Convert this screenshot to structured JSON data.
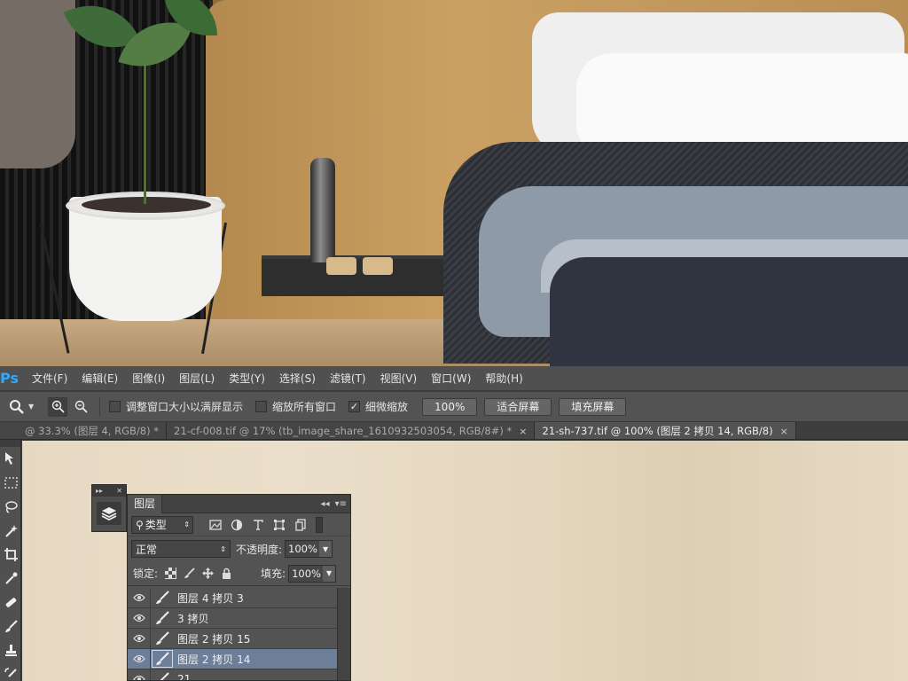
{
  "menu": {
    "logo": "Ps",
    "items": [
      "文件(F)",
      "编辑(E)",
      "图像(I)",
      "图层(L)",
      "类型(Y)",
      "选择(S)",
      "滤镜(T)",
      "视图(V)",
      "窗口(W)",
      "帮助(H)"
    ]
  },
  "options": {
    "tool_icon": "zoom-tool-icon",
    "resize_windows_label": "调整窗口大小以满屏显示",
    "resize_windows_checked": false,
    "zoom_all_label": "缩放所有窗口",
    "zoom_all_checked": false,
    "scrubby_zoom_label": "细微缩放",
    "scrubby_zoom_checked": true,
    "btn_100": "100%",
    "btn_fit": "适合屏幕",
    "btn_fill": "填充屏幕"
  },
  "tabs": [
    {
      "label": "@ 33.3% (图层 4, RGB/8) *",
      "active": false
    },
    {
      "label": "21-cf-008.tif @ 17% (tb_image_share_1610932503054, RGB/8#) *",
      "active": false
    },
    {
      "label": "21-sh-737.tif @ 100% (图层 2 拷贝 14, RGB/8)",
      "active": true
    }
  ],
  "tab_close_glyph": "×",
  "layers_panel": {
    "title": "图层",
    "kind_label": "类型",
    "blend_mode": "正常",
    "opacity_label": "不透明度:",
    "opacity_value": "100%",
    "lock_label": "锁定:",
    "fill_label": "填充:",
    "fill_value": "100%",
    "layers": [
      {
        "name": "图层 4 拷贝 3",
        "visible": true,
        "selected": false
      },
      {
        "name": "3 拷贝",
        "visible": true,
        "selected": false
      },
      {
        "name": "图层 2 拷贝 15",
        "visible": true,
        "selected": false
      },
      {
        "name": "图层 2 拷贝 14",
        "visible": true,
        "selected": true
      },
      {
        "name": "21",
        "visible": true,
        "selected": false
      }
    ]
  },
  "colors": {
    "ui_dark": "#535353",
    "selected_layer": "#6d7e99",
    "ps_blue": "#31a8ff"
  }
}
